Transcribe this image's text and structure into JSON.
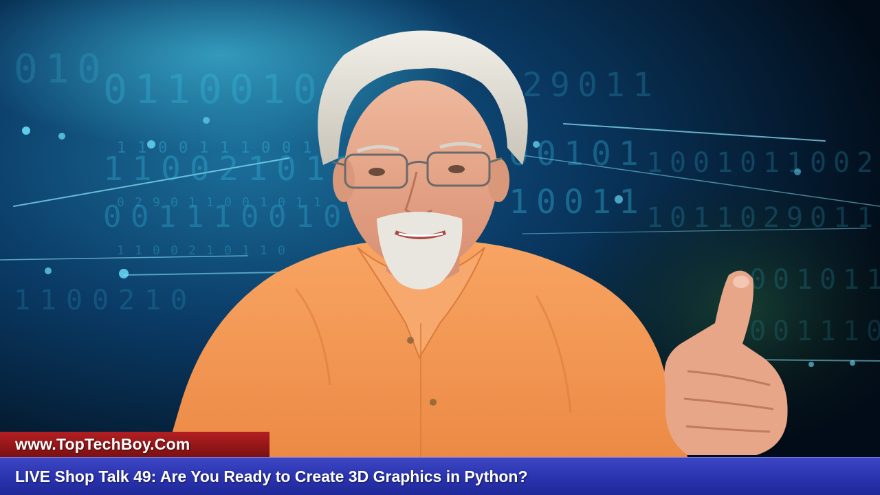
{
  "lower_third": {
    "site_url": "www.TopTechBoy.Com",
    "episode_title": "LIVE Shop Talk 49: Are You Ready to Create 3D Graphics in Python?"
  },
  "background": {
    "binary_glyphs": [
      "0",
      "1",
      "1",
      "0",
      "0",
      "1",
      "0",
      "1",
      "1",
      "0",
      "0",
      "1",
      "1",
      "1",
      "0",
      "0",
      "1",
      "0",
      "1",
      "1",
      "0",
      "0",
      "2",
      "1",
      "0",
      "1",
      "1",
      "0",
      "2",
      "9"
    ]
  },
  "colors": {
    "background_dark": "#02101f",
    "binary_glow": "#39c6ea",
    "shirt": "#f59a55",
    "site_banner": "#b21f22",
    "title_bar": "#2a33ad"
  }
}
